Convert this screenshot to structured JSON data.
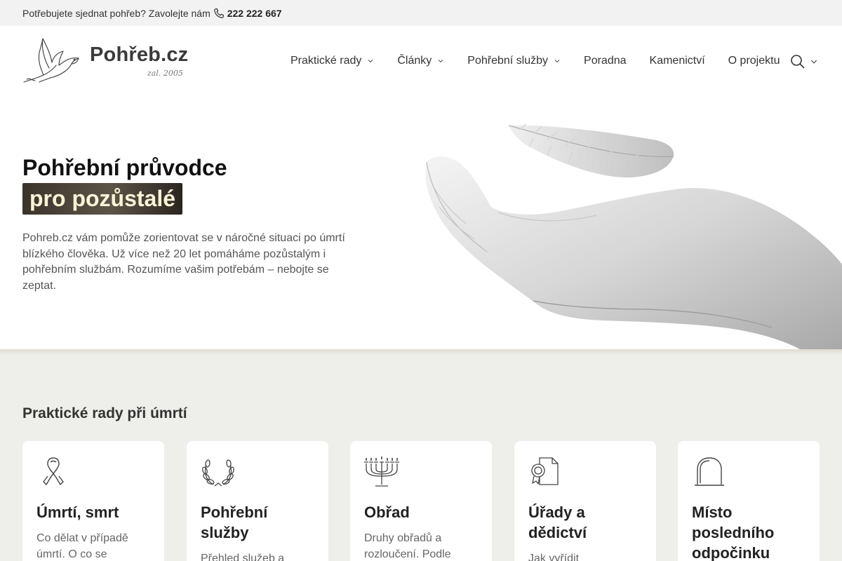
{
  "topbar": {
    "prompt": "Potřebujete sjednat pohřeb? Zavolejte nám",
    "phone": "222 222 667"
  },
  "header": {
    "logo_name": "Pohřeb.cz",
    "logo_established": "zal. 2005",
    "nav": [
      {
        "label": "Praktické rady",
        "has_dropdown": true
      },
      {
        "label": "Články",
        "has_dropdown": true
      },
      {
        "label": "Pohřební služby",
        "has_dropdown": true
      },
      {
        "label": "Poradna",
        "has_dropdown": false
      },
      {
        "label": "Kamenictví",
        "has_dropdown": false
      },
      {
        "label": "O projektu",
        "has_dropdown": false
      }
    ],
    "search_icon": "search-icon"
  },
  "hero": {
    "title_line1": "Pohřební průvodce",
    "title_line2": "pro pozůstalé",
    "description": "Pohreb.cz vám pomůže zorientovat se v náročné situaci po úmrtí blízkého člověka. Už více než 20 let pomáháme pozůstalým i pohřebním službám. Rozumíme vašim potřebám – nebojte se zeptat."
  },
  "section": {
    "title": "Praktické rady při úmrtí",
    "cards": [
      {
        "icon": "ribbon-icon",
        "title": "Úmrtí, smrt",
        "text": "Co dělat v případě úmrtí. O co se postarat"
      },
      {
        "icon": "laurel-wreath-icon",
        "title": "Pohřební služby",
        "text": "Přehled služeb a"
      },
      {
        "icon": "candelabra-icon",
        "title": "Obřad",
        "text": "Druhy obřadů a rozloučení. Podle čeho"
      },
      {
        "icon": "document-seal-icon",
        "title": "Úřady a dědictví",
        "text": "Jak vyřídit"
      },
      {
        "icon": "tombstone-icon",
        "title": "Místo posledního odpočinku",
        "text": ""
      }
    ]
  },
  "colors": {
    "topbar_bg": "#f2f2f2",
    "section_bg": "#eeeeea",
    "highlight_text": "#fbf3d6",
    "highlight_bg": "#4a4238"
  }
}
